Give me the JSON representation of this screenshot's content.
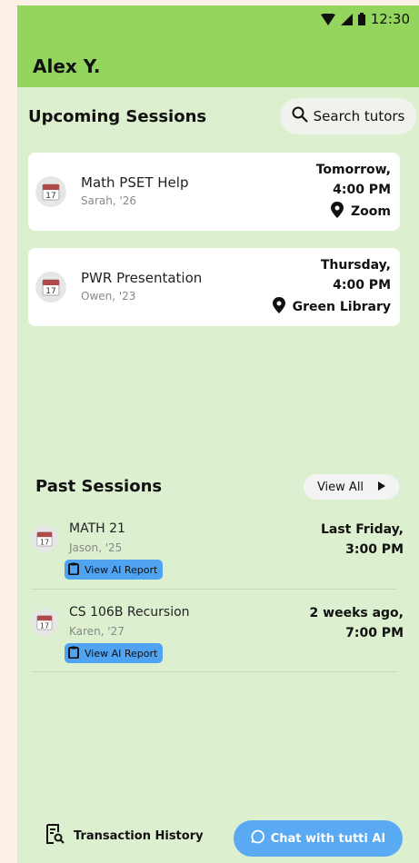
{
  "status_bar": {
    "time": "12:30"
  },
  "header": {
    "user_name": "Alex Y."
  },
  "upcoming": {
    "title": "Upcoming Sessions",
    "search_label": "Search tutors",
    "sessions": [
      {
        "title": "Math PSET Help",
        "tutor": "Sarah, '26",
        "day": "Tomorrow,",
        "time": "4:00 PM",
        "location": "Zoom"
      },
      {
        "title": "PWR Presentation",
        "tutor": "Owen, '23",
        "day": "Thursday,",
        "time": "4:00 PM",
        "location": "Green Library"
      }
    ]
  },
  "past": {
    "title": "Past Sessions",
    "view_all_label": "View All",
    "report_label": "View AI Report",
    "sessions": [
      {
        "title": "MATH 21",
        "tutor": "Jason, '25",
        "day": "Last Friday,",
        "time": "3:00 PM"
      },
      {
        "title": "CS 106B Recursion",
        "tutor": "Karen, '27",
        "day": "2 weeks ago,",
        "time": "7:00 PM"
      }
    ]
  },
  "calendar_icon_day": "17",
  "footer": {
    "transaction_label": "Transaction History",
    "chat_label": "Chat with tutti AI"
  },
  "colors": {
    "header": "#94d55d",
    "background": "#dcefcf",
    "accent_blue": "#5aa9f3",
    "report_blue": "#4fa3f1"
  },
  "icons": [
    "wifi-icon",
    "signal-icon",
    "battery-icon",
    "search-icon",
    "calendar-icon",
    "location-pin-icon",
    "play-arrow-icon",
    "clipboard-icon",
    "receipt-search-icon",
    "chat-bubble-icon"
  ]
}
